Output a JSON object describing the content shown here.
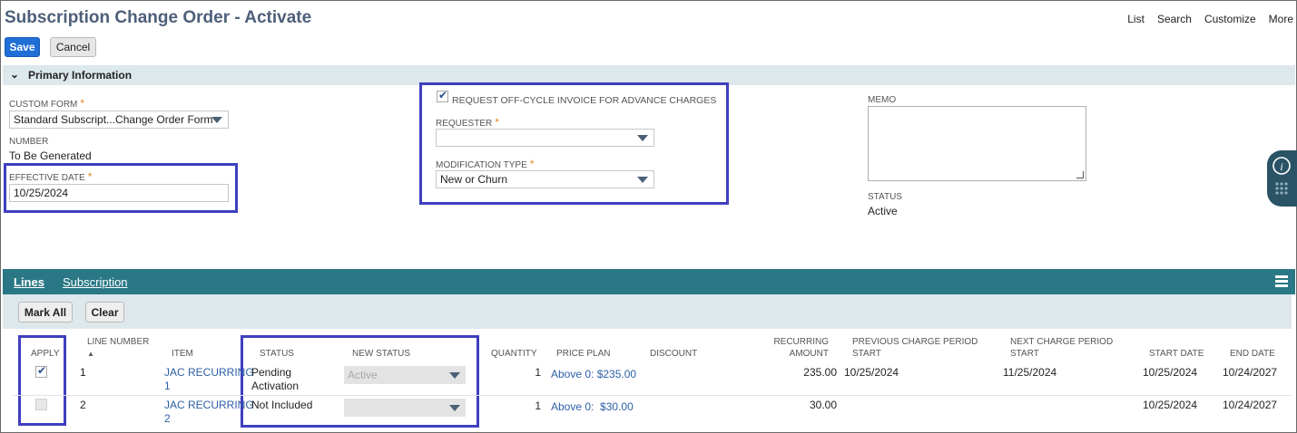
{
  "page": {
    "title": "Subscription Change Order - Activate",
    "top_links": [
      "List",
      "Search",
      "Customize",
      "More"
    ],
    "save_label": "Save",
    "cancel_label": "Cancel"
  },
  "primary": {
    "section_label": "Primary Information",
    "custom_form_label": "CUSTOM FORM",
    "custom_form_value": "Standard Subscript...Change Order Form",
    "number_label": "NUMBER",
    "number_value": "To Be Generated",
    "effective_date_label": "EFFECTIVE DATE",
    "effective_date_value": "10/25/2024",
    "offcycle_label": "REQUEST OFF-CYCLE INVOICE FOR ADVANCE CHARGES",
    "offcycle_checked": true,
    "requester_label": "REQUESTER",
    "requester_value": "",
    "modification_type_label": "MODIFICATION TYPE",
    "modification_type_value": "New or Churn",
    "memo_label": "MEMO",
    "memo_value": "",
    "status_label": "STATUS",
    "status_value": "Active",
    "required_mark": "*"
  },
  "tabs": {
    "lines": "Lines",
    "subscription": "Subscription"
  },
  "lines": {
    "mark_all_label": "Mark All",
    "clear_label": "Clear",
    "columns": {
      "apply": "APPLY",
      "line_number": "LINE NUMBER",
      "sort_arrow": "▲",
      "item": "ITEM",
      "status": "STATUS",
      "new_status": "NEW STATUS",
      "quantity": "QUANTITY",
      "price_plan": "PRICE PLAN",
      "discount": "DISCOUNT",
      "recurring_amount_1": "RECURRING",
      "recurring_amount_2": "AMOUNT",
      "prev_charge_1": "PREVIOUS CHARGE PERIOD",
      "prev_charge_2": "START",
      "next_charge_1": "NEXT CHARGE PERIOD",
      "next_charge_2": "START",
      "start_date": "START DATE",
      "end_date": "END DATE"
    },
    "rows": [
      {
        "apply": true,
        "line_number": "1",
        "item_1": "JAC RECURRING",
        "item_2": "1",
        "status_1": "Pending",
        "status_2": "Activation",
        "new_status": "Active",
        "quantity": "1",
        "price_plan": "Above 0: $235.00",
        "recurring_amount": "235.00",
        "prev_charge_start": "10/25/2024",
        "next_charge_start": "11/25/2024",
        "start_date": "10/25/2024",
        "end_date": "10/24/2027"
      },
      {
        "apply": false,
        "line_number": "2",
        "item_1": "JAC RECURRING",
        "item_2": "2",
        "status_1": "Not Included",
        "status_2": "",
        "new_status": "",
        "quantity": "1",
        "price_plan": "Above 0:  $30.00",
        "recurring_amount": "30.00",
        "prev_charge_start": "",
        "next_charge_start": "",
        "start_date": "10/25/2024",
        "end_date": "10/24/2027"
      }
    ]
  },
  "colors": {
    "title": "#4d5f79",
    "save_button": "#1f6fd6",
    "section_bar": "#dde8ec",
    "tab_bar": "#2a7885",
    "highlight_box": "#3f3fbf",
    "link": "#2d5fa6",
    "required": "#e08a1e"
  }
}
